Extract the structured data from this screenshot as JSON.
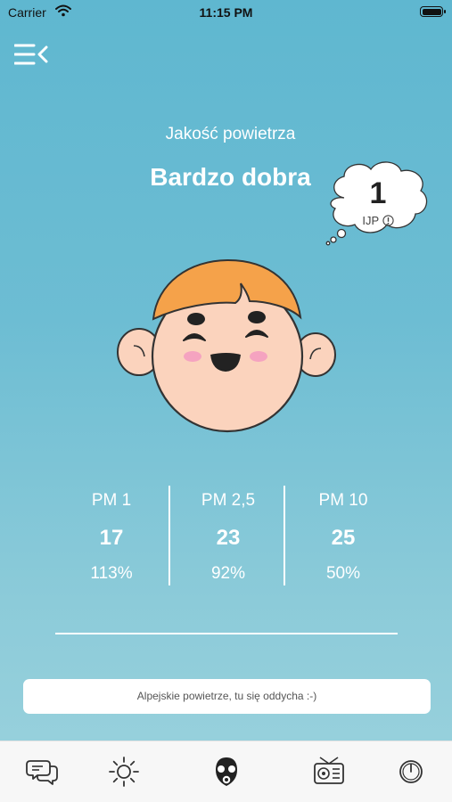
{
  "status_bar": {
    "carrier": "Carrier",
    "time": "11:15 PM"
  },
  "header": {
    "menu_icon": "menu-collapse-icon"
  },
  "air_quality": {
    "label": "Jakość powietrza",
    "value": "Bardzo dobra",
    "index": "1",
    "index_label": "IJP",
    "info_icon": "info-icon"
  },
  "face_mood": "happy",
  "pollutants": [
    {
      "name": "PM 1",
      "value": "17",
      "percent": "113%"
    },
    {
      "name": "PM 2,5",
      "value": "23",
      "percent": "92%"
    },
    {
      "name": "PM 10",
      "value": "25",
      "percent": "50%"
    }
  ],
  "message": "Alpejskie powietrze, tu się oddycha :-)",
  "tabs": [
    {
      "icon": "chat-icon",
      "active": false
    },
    {
      "icon": "sun-icon",
      "active": false
    },
    {
      "icon": "gas-mask-icon",
      "active": true
    },
    {
      "icon": "radio-icon",
      "active": false
    },
    {
      "icon": "power-icon",
      "active": false
    }
  ],
  "colors": {
    "background_top": "#5fb7d0",
    "background_bottom": "#9bd2dd",
    "hair": "#f5a24a",
    "skin": "#fbd3bd",
    "cheeks": "#f5a3c0"
  }
}
